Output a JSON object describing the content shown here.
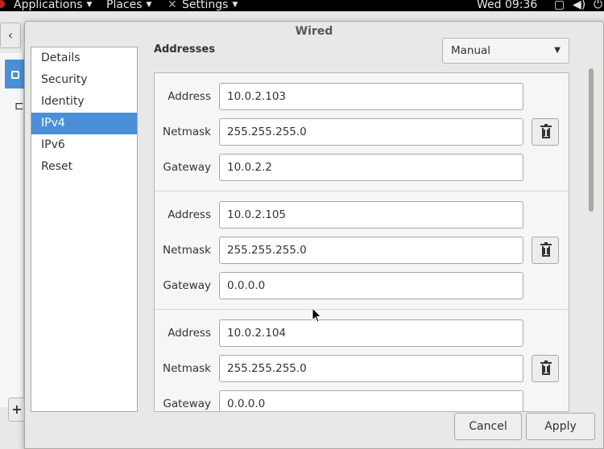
{
  "top_panel": {
    "applications": "Applications",
    "places": "Places",
    "settings": "Settings",
    "clock": "Wed 09:36"
  },
  "dialog": {
    "title": "Wired",
    "nav": [
      {
        "label": "Details",
        "selected": false
      },
      {
        "label": "Security",
        "selected": false
      },
      {
        "label": "Identity",
        "selected": false
      },
      {
        "label": "IPv4",
        "selected": true
      },
      {
        "label": "IPv6",
        "selected": false
      },
      {
        "label": "Reset",
        "selected": false
      }
    ],
    "addresses_label": "Addresses",
    "method_value": "Manual",
    "labels": {
      "address": "Address",
      "netmask": "Netmask",
      "gateway": "Gateway"
    },
    "addresses": [
      {
        "address": "10.0.2.103",
        "netmask": "255.255.255.0",
        "gateway": "10.0.2.2"
      },
      {
        "address": "10.0.2.105",
        "netmask": "255.255.255.0",
        "gateway": "0.0.0.0"
      },
      {
        "address": "10.0.2.104",
        "netmask": "255.255.255.0",
        "gateway": "0.0.0.0"
      }
    ],
    "cancel_label": "Cancel",
    "apply_label": "Apply"
  },
  "background": {
    "back_symbol": "‹",
    "plus_symbol": "+"
  },
  "colors": {
    "accent": "#4a90d9",
    "panel": "#000000",
    "dialog_bg": "#e8e8e7"
  }
}
